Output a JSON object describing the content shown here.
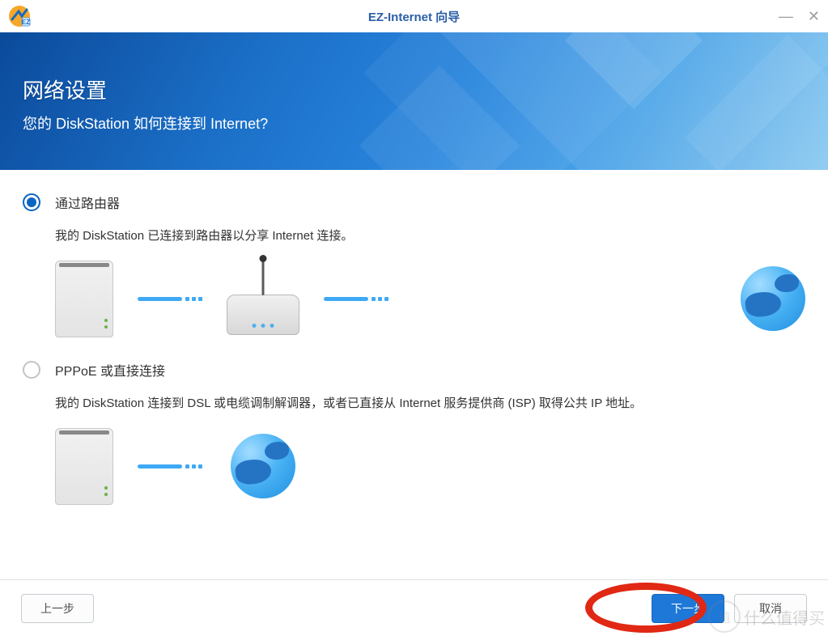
{
  "window": {
    "title": "EZ-Internet 向导"
  },
  "banner": {
    "heading": "网络设置",
    "subheading": "您的 DiskStation 如何连接到 Internet?"
  },
  "options": {
    "router": {
      "title": "通过路由器",
      "desc": "我的 DiskStation 已连接到路由器以分享 Internet 连接。"
    },
    "pppoe": {
      "title": "PPPoE 或直接连接",
      "desc": "我的 DiskStation 连接到 DSL 或电缆调制解调器，或者已直接从 Internet 服务提供商 (ISP) 取得公共 IP 地址。"
    }
  },
  "footer": {
    "back": "上一步",
    "next": "下一步",
    "cancel": "取消"
  },
  "watermark": {
    "seal": "值",
    "text": "什么值得买"
  }
}
